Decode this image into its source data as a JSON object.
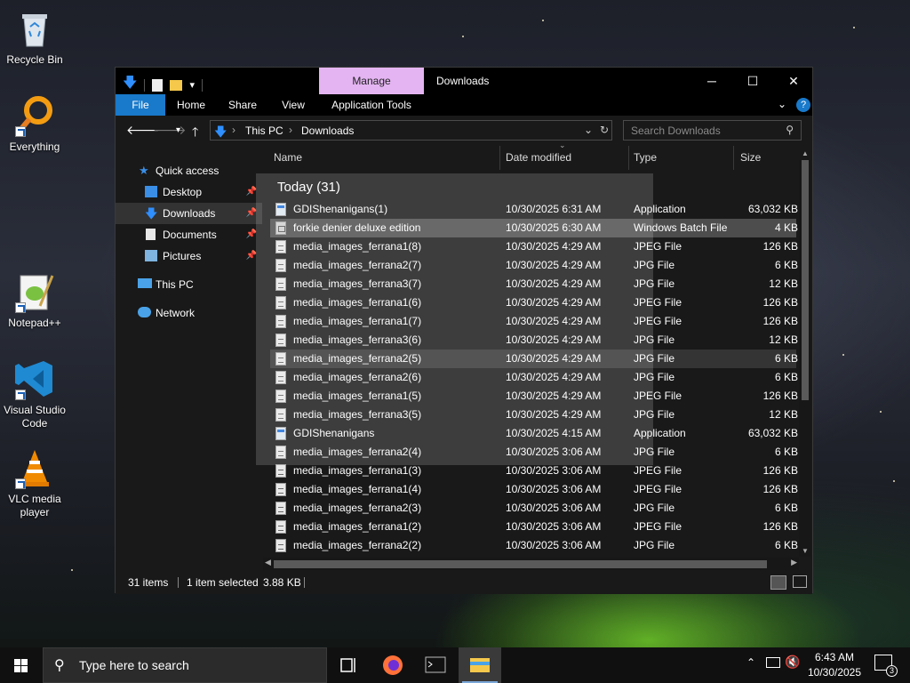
{
  "desktop": {
    "icons": [
      {
        "label": "Recycle Bin"
      },
      {
        "label": "Everything"
      },
      {
        "label": "Notepad++"
      },
      {
        "label": "Visual Studio Code"
      },
      {
        "label": "VLC media player"
      }
    ]
  },
  "window": {
    "title": "Downloads",
    "context_tab": "Manage",
    "ribbon_tabs": [
      "File",
      "Home",
      "Share",
      "View",
      "Application Tools"
    ],
    "breadcrumb": [
      "This PC",
      "Downloads"
    ],
    "search_placeholder": "Search Downloads"
  },
  "nav": {
    "items": [
      {
        "label": "Quick access",
        "icon": "star-icon"
      },
      {
        "label": "Desktop",
        "icon": "desktop-icon",
        "pinned": true
      },
      {
        "label": "Downloads",
        "icon": "download-icon",
        "pinned": true,
        "selected": true
      },
      {
        "label": "Documents",
        "icon": "documents-icon",
        "pinned": true
      },
      {
        "label": "Pictures",
        "icon": "pictures-icon",
        "pinned": true
      },
      {
        "label": "This PC",
        "icon": "pc-icon"
      },
      {
        "label": "Network",
        "icon": "network-icon"
      }
    ]
  },
  "columns": {
    "name": "Name",
    "date": "Date modified",
    "type": "Type",
    "size": "Size"
  },
  "group_header": "Today (31)",
  "files": [
    {
      "name": "GDIShenanigans(1)",
      "date": "10/30/2025 6:31 AM",
      "type": "Application",
      "size": "63,032 KB",
      "icon": "app"
    },
    {
      "name": "forkie denier deluxe edition",
      "date": "10/30/2025 6:30 AM",
      "type": "Windows Batch File",
      "size": "4 KB",
      "icon": "bat"
    },
    {
      "name": "media_images_ferrana1(8)",
      "date": "10/30/2025 4:29 AM",
      "type": "JPEG File",
      "size": "126 KB",
      "icon": "img"
    },
    {
      "name": "media_images_ferrana2(7)",
      "date": "10/30/2025 4:29 AM",
      "type": "JPG File",
      "size": "6 KB",
      "icon": "img"
    },
    {
      "name": "media_images_ferrana3(7)",
      "date": "10/30/2025 4:29 AM",
      "type": "JPG File",
      "size": "12 KB",
      "icon": "img"
    },
    {
      "name": "media_images_ferrana1(6)",
      "date": "10/30/2025 4:29 AM",
      "type": "JPEG File",
      "size": "126 KB",
      "icon": "img"
    },
    {
      "name": "media_images_ferrana1(7)",
      "date": "10/30/2025 4:29 AM",
      "type": "JPEG File",
      "size": "126 KB",
      "icon": "img"
    },
    {
      "name": "media_images_ferrana3(6)",
      "date": "10/30/2025 4:29 AM",
      "type": "JPG File",
      "size": "12 KB",
      "icon": "img"
    },
    {
      "name": "media_images_ferrana2(5)",
      "date": "10/30/2025 4:29 AM",
      "type": "JPG File",
      "size": "6 KB",
      "icon": "img"
    },
    {
      "name": "media_images_ferrana2(6)",
      "date": "10/30/2025 4:29 AM",
      "type": "JPG File",
      "size": "6 KB",
      "icon": "img"
    },
    {
      "name": "media_images_ferrana1(5)",
      "date": "10/30/2025 4:29 AM",
      "type": "JPEG File",
      "size": "126 KB",
      "icon": "img"
    },
    {
      "name": "media_images_ferrana3(5)",
      "date": "10/30/2025 4:29 AM",
      "type": "JPG File",
      "size": "12 KB",
      "icon": "img"
    },
    {
      "name": "GDIShenanigans",
      "date": "10/30/2025 4:15 AM",
      "type": "Application",
      "size": "63,032 KB",
      "icon": "app"
    },
    {
      "name": "media_images_ferrana2(4)",
      "date": "10/30/2025 3:06 AM",
      "type": "JPG File",
      "size": "6 KB",
      "icon": "img"
    },
    {
      "name": "media_images_ferrana1(3)",
      "date": "10/30/2025 3:06 AM",
      "type": "JPEG File",
      "size": "126 KB",
      "icon": "img"
    },
    {
      "name": "media_images_ferrana1(4)",
      "date": "10/30/2025 3:06 AM",
      "type": "JPEG File",
      "size": "126 KB",
      "icon": "img"
    },
    {
      "name": "media_images_ferrana2(3)",
      "date": "10/30/2025 3:06 AM",
      "type": "JPG File",
      "size": "6 KB",
      "icon": "img"
    },
    {
      "name": "media_images_ferrana1(2)",
      "date": "10/30/2025 3:06 AM",
      "type": "JPEG File",
      "size": "126 KB",
      "icon": "img"
    },
    {
      "name": "media_images_ferrana2(2)",
      "date": "10/30/2025 3:06 AM",
      "type": "JPG File",
      "size": "6 KB",
      "icon": "img"
    }
  ],
  "status": {
    "count": "31 items",
    "selected": "1 item selected",
    "size": "3.88 KB"
  },
  "taskbar": {
    "search_placeholder": "Type here to search",
    "time": "6:43 AM",
    "date": "10/30/2025",
    "notification_count": "3"
  },
  "colors": {
    "accent": "#1979ca",
    "manage_tab": "#e4b4f2",
    "window_bg": "#191919"
  }
}
